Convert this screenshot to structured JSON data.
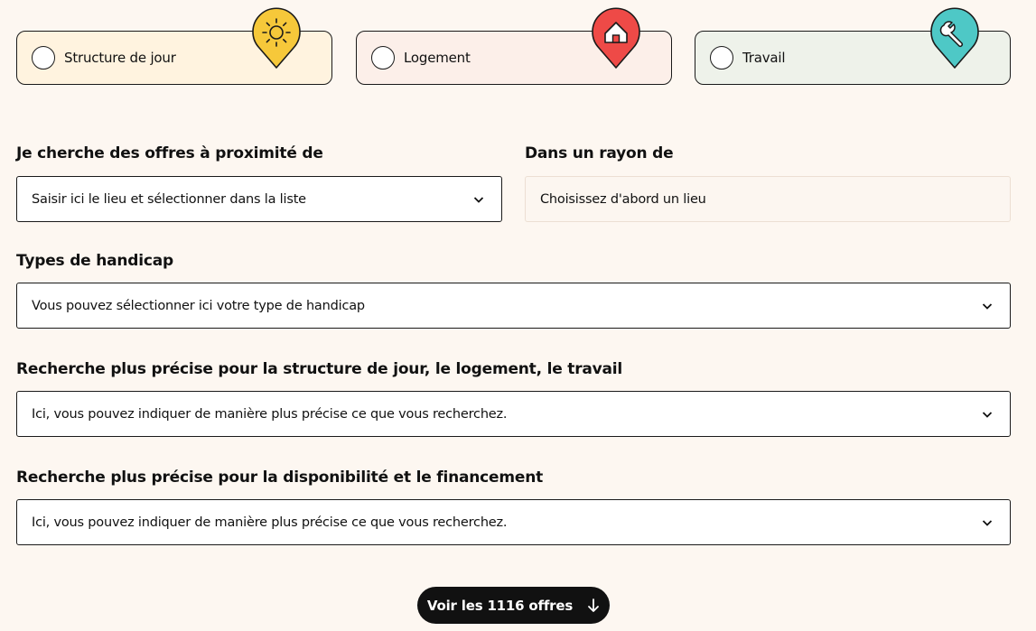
{
  "categories": [
    {
      "label": "Structure de jour",
      "icon": "sun-icon",
      "bg": "#fff3df",
      "pin_color": "#f6c83a"
    },
    {
      "label": "Logement",
      "icon": "house-icon",
      "bg": "#fcefe9",
      "pin_color": "#ee4a47"
    },
    {
      "label": "Travail",
      "icon": "wrench-icon",
      "bg": "#eef2ea",
      "pin_color": "#4ec8c6"
    }
  ],
  "location": {
    "label": "Je cherche des offres à proximité de",
    "placeholder": "Saisir ici le lieu et sélectionner dans la liste"
  },
  "radius": {
    "label": "Dans un rayon de",
    "placeholder": "Choisissez d'abord un lieu"
  },
  "handicap": {
    "label": "Types de handicap",
    "placeholder": "Vous pouvez sélectionner ici votre type de handicap"
  },
  "precise_structure": {
    "label": "Recherche plus précise pour la structure de jour, le logement, le travail",
    "placeholder": "Ici, vous pouvez indiquer de manière plus précise ce que vous recherchez."
  },
  "precise_financing": {
    "label": "Recherche plus précise pour la disponibilité et le financement",
    "placeholder": "Ici, vous pouvez indiquer de manière plus précise ce que vous recherchez."
  },
  "cta": {
    "label": "Voir les 1116 offres",
    "icon": "arrow-down-icon"
  }
}
